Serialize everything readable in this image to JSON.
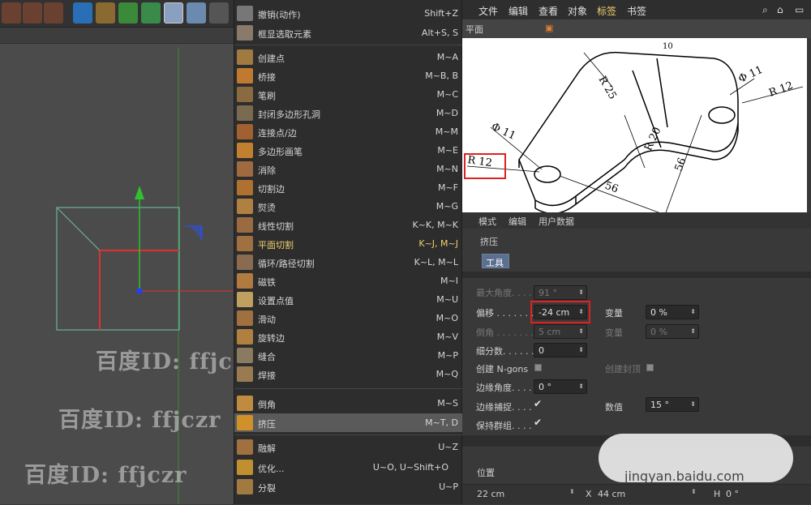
{
  "menu": {
    "items": [
      {
        "label": "撤销(动作)",
        "shortcut": "Shift+Z"
      },
      {
        "label": "框显选取元素",
        "shortcut": "Alt+S, S"
      },
      {
        "label": "创建点",
        "shortcut": "M~A"
      },
      {
        "label": "桥接",
        "shortcut": "M~B, B"
      },
      {
        "label": "笔刷",
        "shortcut": "M~C"
      },
      {
        "label": "封闭多边形孔洞",
        "shortcut": "M~D"
      },
      {
        "label": "连接点/边",
        "shortcut": "M~M"
      },
      {
        "label": "多边形画笔",
        "shortcut": "M~E"
      },
      {
        "label": "消除",
        "shortcut": "M~N"
      },
      {
        "label": "切割边",
        "shortcut": "M~F"
      },
      {
        "label": "熨烫",
        "shortcut": "M~G"
      },
      {
        "label": "线性切割",
        "shortcut": "K~K, M~K"
      },
      {
        "label": "平面切割",
        "shortcut": "K~J, M~J"
      },
      {
        "label": "循环/路径切割",
        "shortcut": "K~L, M~L"
      },
      {
        "label": "磁铁",
        "shortcut": "M~I"
      },
      {
        "label": "设置点值",
        "shortcut": "M~U"
      },
      {
        "label": "滑动",
        "shortcut": "M~O"
      },
      {
        "label": "旋转边",
        "shortcut": "M~V"
      },
      {
        "label": "缝合",
        "shortcut": "M~P"
      },
      {
        "label": "焊接",
        "shortcut": "M~Q"
      },
      {
        "label": "倒角",
        "shortcut": "M~S"
      },
      {
        "label": "挤压",
        "shortcut": "M~T, D"
      },
      {
        "label": "融解",
        "shortcut": "U~Z"
      },
      {
        "label": "优化...",
        "shortcut": "U~O, U~Shift+O"
      },
      {
        "label": "分裂",
        "shortcut": "U~P"
      }
    ]
  },
  "menubar": {
    "file": "文件",
    "edit": "编辑",
    "view": "查看",
    "object": "对象",
    "tags": "标签",
    "bookmarks": "书签"
  },
  "view_tab": {
    "label": "平面"
  },
  "drawing": {
    "dim_10": "10",
    "dim_r25": "R 25",
    "dim_phi11_right": "Φ 11",
    "dim_r12_right": "R 12",
    "dim_phi11_left": "Φ 11",
    "dim_r12_left": "R 12",
    "dim_r20": "R 20",
    "dim_56_right": "56",
    "dim_56_bottom": "56"
  },
  "attributes": {
    "tabs": {
      "mode": "模式",
      "edit": "编辑",
      "user_data": "用户数据"
    },
    "title": "挤压",
    "tool_tab": "工具",
    "max_angle": {
      "label": "最大角度. . . .",
      "value": "91 °"
    },
    "offset": {
      "label": "偏移 . . . . . . .",
      "value": "-24 cm"
    },
    "variance": {
      "label": "变量",
      "value": "0 %"
    },
    "bevel": {
      "label": "倒角 . . . . . . .",
      "value": "5 cm"
    },
    "variance2": {
      "label": "变量",
      "value": "0 %"
    },
    "subdivision": {
      "label": "细分数. . . . . .",
      "value": "0"
    },
    "create_ngons": {
      "label": "创建 N-gons"
    },
    "create_caps": {
      "label": "创建封顶"
    },
    "edge_angle": {
      "label": "边缘角度. . . .",
      "value": "0 °"
    },
    "edge_snap": {
      "label": "边缘捕捉. . . ."
    },
    "value_field": {
      "label": "数值",
      "value": "15 °"
    },
    "preserve_groups": {
      "label": "保持群组. . . ."
    }
  },
  "coords": {
    "position_label": "位置",
    "x_value": "22 cm",
    "x_label": "X",
    "y_value": "44 cm",
    "h_label": "H",
    "h_value": "0 °"
  },
  "watermark": {
    "text": "百度ID: ffjczr",
    "site": "jingyan.baidu.com"
  }
}
